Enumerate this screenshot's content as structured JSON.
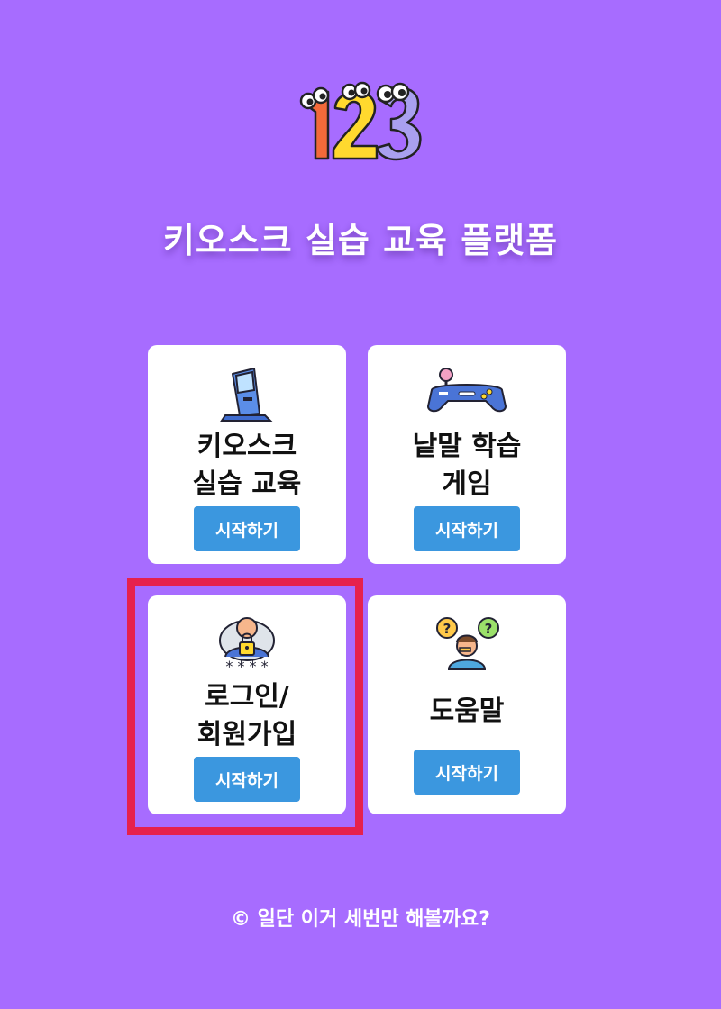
{
  "app": {
    "logo_icon": "cartoon-123-numbers-logo",
    "title": "키오스크 실습 교육 플랫폼",
    "background_color": "#a76cff"
  },
  "menu_cards": [
    {
      "label": "키오스크\n실습 교육",
      "button_label": "시작하기",
      "icon": "kiosk-machine-icon"
    },
    {
      "label": "낱말 학습\n게임",
      "button_label": "시작하기",
      "icon": "game-controller-icon"
    },
    {
      "label": "로그인/\n회원가입",
      "button_label": "시작하기",
      "icon": "user-lock-password-icon",
      "highlighted": true
    },
    {
      "label": "도움말",
      "button_label": "시작하기",
      "icon": "confused-person-question-icon"
    }
  ],
  "colors": {
    "button": "#3b97df",
    "highlight_border": "#e6214c",
    "card": "#ffffff"
  },
  "footer": {
    "text": "© 일단 이거 세번만 해볼까요?"
  }
}
